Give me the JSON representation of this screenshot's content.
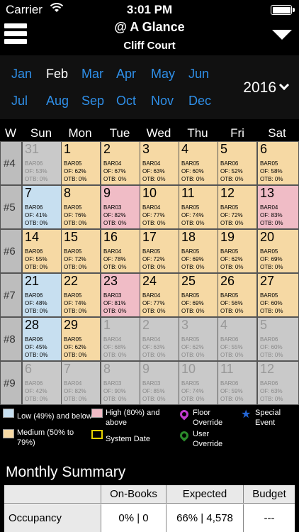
{
  "status": {
    "carrier": "Carrier",
    "time": "3:01 PM"
  },
  "header": {
    "title": "@ A Glance",
    "subtitle": "Cliff Court"
  },
  "months": {
    "row1": [
      "Jan",
      "Feb",
      "Mar",
      "Apr",
      "May",
      "Jun"
    ],
    "row2": [
      "Jul",
      "Aug",
      "Sep",
      "Oct",
      "Nov",
      "Dec"
    ],
    "selected": "Feb",
    "year": "2016"
  },
  "day_headers": [
    "W",
    "Sun",
    "Mon",
    "Tue",
    "Wed",
    "Thu",
    "Fri",
    "Sat"
  ],
  "weeks": [
    {
      "label": "#4",
      "days": [
        {
          "day": "31",
          "bar": "BAR06",
          "of": "OF: 53%",
          "otb": "OTB: 0%",
          "cat": "out"
        },
        {
          "day": "1",
          "bar": "BAR05",
          "of": "OF: 62%",
          "otb": "OTB: 0%",
          "cat": "med"
        },
        {
          "day": "2",
          "bar": "BAR04",
          "of": "OF: 67%",
          "otb": "OTB: 0%",
          "cat": "med"
        },
        {
          "day": "3",
          "bar": "BAR04",
          "of": "OF: 63%",
          "otb": "OTB: 0%",
          "cat": "med"
        },
        {
          "day": "4",
          "bar": "BAR05",
          "of": "OF: 60%",
          "otb": "OTB: 0%",
          "cat": "med"
        },
        {
          "day": "5",
          "bar": "BAR06",
          "of": "OF: 52%",
          "otb": "OTB: 0%",
          "cat": "med"
        },
        {
          "day": "6",
          "bar": "BAR05",
          "of": "OF: 58%",
          "otb": "OTB: 0%",
          "cat": "med"
        }
      ]
    },
    {
      "label": "#5",
      "days": [
        {
          "day": "7",
          "bar": "BAR06",
          "of": "OF: 41%",
          "otb": "OTB: 0%",
          "cat": "low"
        },
        {
          "day": "8",
          "bar": "BAR05",
          "of": "OF: 76%",
          "otb": "OTB: 0%",
          "cat": "med"
        },
        {
          "day": "9",
          "bar": "BAR03",
          "of": "OF: 82%",
          "otb": "OTB: 0%",
          "cat": "high"
        },
        {
          "day": "10",
          "bar": "BAR04",
          "of": "OF: 77%",
          "otb": "OTB: 0%",
          "cat": "med"
        },
        {
          "day": "11",
          "bar": "BAR05",
          "of": "OF: 74%",
          "otb": "OTB: 0%",
          "cat": "med"
        },
        {
          "day": "12",
          "bar": "BAR05",
          "of": "OF: 72%",
          "otb": "OTB: 0%",
          "cat": "med"
        },
        {
          "day": "13",
          "bar": "BAR04",
          "of": "OF: 83%",
          "otb": "OTB: 0%",
          "cat": "high"
        }
      ]
    },
    {
      "label": "#6",
      "days": [
        {
          "day": "14",
          "bar": "BAR06",
          "of": "OF: 55%",
          "otb": "OTB: 0%",
          "cat": "med"
        },
        {
          "day": "15",
          "bar": "BAR05",
          "of": "OF: 72%",
          "otb": "OTB: 0%",
          "cat": "med"
        },
        {
          "day": "16",
          "bar": "BAR04",
          "of": "OF: 78%",
          "otb": "OTB: 0%",
          "cat": "med"
        },
        {
          "day": "17",
          "bar": "BAR05",
          "of": "OF: 72%",
          "otb": "OTB: 0%",
          "cat": "med"
        },
        {
          "day": "18",
          "bar": "BAR05",
          "of": "OF: 69%",
          "otb": "OTB: 0%",
          "cat": "med"
        },
        {
          "day": "19",
          "bar": "BAR05",
          "of": "OF: 62%",
          "otb": "OTB: 0%",
          "cat": "med"
        },
        {
          "day": "20",
          "bar": "BAR05",
          "of": "OF: 69%",
          "otb": "OTB: 0%",
          "cat": "med"
        }
      ]
    },
    {
      "label": "#7",
      "days": [
        {
          "day": "21",
          "bar": "BAR06",
          "of": "OF: 48%",
          "otb": "OTB: 0%",
          "cat": "low"
        },
        {
          "day": "22",
          "bar": "BAR05",
          "of": "OF: 74%",
          "otb": "OTB: 0%",
          "cat": "med"
        },
        {
          "day": "23",
          "bar": "BAR03",
          "of": "OF: 81%",
          "otb": "OTB: 0%",
          "cat": "high"
        },
        {
          "day": "24",
          "bar": "BAR04",
          "of": "OF: 77%",
          "otb": "OTB: 0%",
          "cat": "med"
        },
        {
          "day": "25",
          "bar": "BAR05",
          "of": "OF: 69%",
          "otb": "OTB: 0%",
          "cat": "med"
        },
        {
          "day": "26",
          "bar": "BAR05",
          "of": "OF: 56%",
          "otb": "OTB: 0%",
          "cat": "med"
        },
        {
          "day": "27",
          "bar": "BAR05",
          "of": "OF: 60%",
          "otb": "OTB: 0%",
          "cat": "med"
        }
      ]
    },
    {
      "label": "#8",
      "days": [
        {
          "day": "28",
          "bar": "BAR06",
          "of": "OF: 45%",
          "otb": "OTB: 0%",
          "cat": "low"
        },
        {
          "day": "29",
          "bar": "BAR05",
          "of": "OF: 62%",
          "otb": "OTB: 0%",
          "cat": "med"
        },
        {
          "day": "1",
          "bar": "BAR04",
          "of": "OF: 68%",
          "otb": "OTB: 0%",
          "cat": "out"
        },
        {
          "day": "2",
          "bar": "BAR04",
          "of": "OF: 63%",
          "otb": "OTB: 0%",
          "cat": "out"
        },
        {
          "day": "3",
          "bar": "BAR05",
          "of": "OF: 62%",
          "otb": "OTB: 0%",
          "cat": "out"
        },
        {
          "day": "4",
          "bar": "BAR06",
          "of": "OF: 55%",
          "otb": "OTB: 0%",
          "cat": "out"
        },
        {
          "day": "5",
          "bar": "BAR06",
          "of": "OF: 60%",
          "otb": "OTB: 0%",
          "cat": "out"
        }
      ]
    },
    {
      "label": "#9",
      "days": [
        {
          "day": "6",
          "bar": "BAR06",
          "of": "OF: 42%",
          "otb": "OTB: 0%",
          "cat": "out"
        },
        {
          "day": "7",
          "bar": "BAR04",
          "of": "OF: 82%",
          "otb": "OTB: 0%",
          "cat": "out"
        },
        {
          "day": "8",
          "bar": "BAR03",
          "of": "OF: 90%",
          "otb": "OTB: 0%",
          "cat": "out"
        },
        {
          "day": "9",
          "bar": "BAR03",
          "of": "OF: 85%",
          "otb": "OTB: 0%",
          "cat": "out"
        },
        {
          "day": "10",
          "bar": "BAR05",
          "of": "OF: 74%",
          "otb": "OTB: 0%",
          "cat": "out"
        },
        {
          "day": "11",
          "bar": "BAR06",
          "of": "OF: 59%",
          "otb": "OTB: 0%",
          "cat": "out"
        },
        {
          "day": "12",
          "bar": "BAR06",
          "of": "OF: 63%",
          "otb": "OTB: 0%",
          "cat": "out"
        }
      ]
    }
  ],
  "legend": {
    "low": "Low (49%) and below",
    "medium": "Medium (50% to 79%)",
    "high": "High (80%) and above",
    "system_date": "System Date",
    "floor_override": "Floor Override",
    "user_override": "User Override",
    "special_event": "Special Event"
  },
  "colors": {
    "low": "#c7dff0",
    "medium": "#f6d9a4",
    "high": "#f0bcc6",
    "out": "#c9c9c9",
    "month_link": "#2f8fe8"
  },
  "summary": {
    "title": "Monthly Summary",
    "columns": [
      "",
      "On-Books",
      "Expected",
      "Budget"
    ],
    "rows": [
      {
        "label": "Occupancy",
        "on_books": "0% | 0",
        "expected": "66% | 4,578",
        "budget": "---"
      }
    ]
  }
}
